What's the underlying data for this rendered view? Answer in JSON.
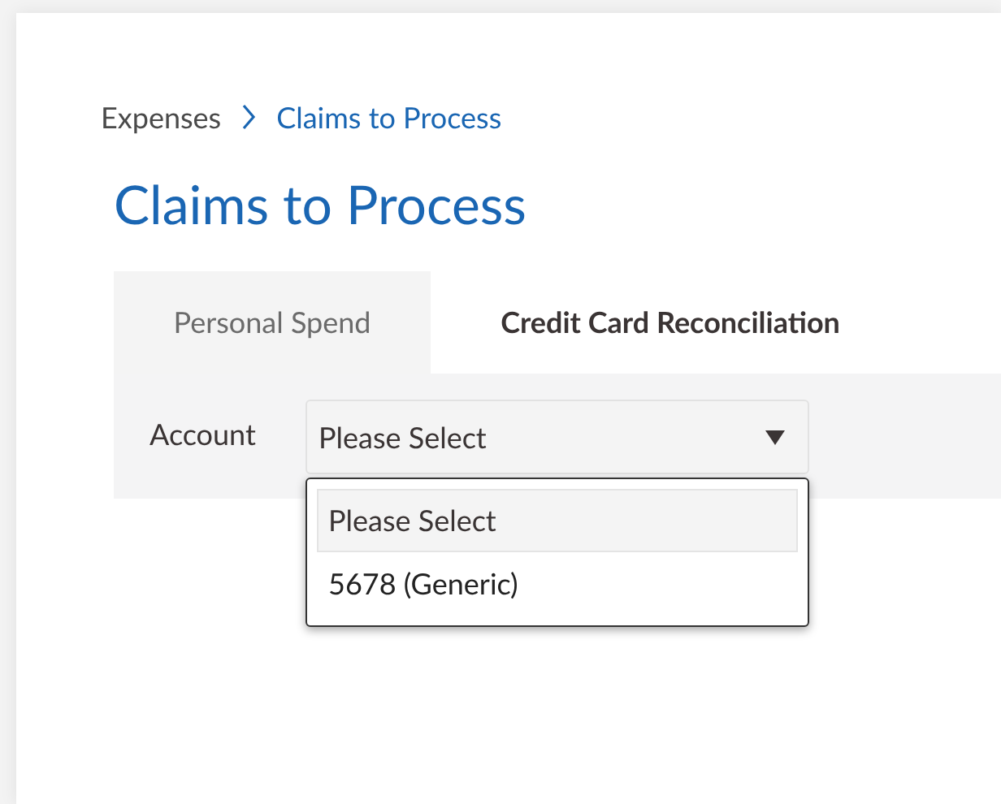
{
  "breadcrumb": [
    {
      "label": "Expenses",
      "current": false
    },
    {
      "label": "Claims to Process",
      "current": true
    }
  ],
  "title": "Claims to Process",
  "tabs": [
    {
      "label": "Personal Spend",
      "selected": false
    },
    {
      "label": "Credit Card Reconciliation",
      "selected": true
    }
  ],
  "account_filter": {
    "label": "Account",
    "value": "Please Select",
    "expanded": true,
    "options": [
      {
        "label": "Please Select",
        "selected": true
      },
      {
        "label": "5678 (Generic)",
        "selected": false
      }
    ]
  }
}
